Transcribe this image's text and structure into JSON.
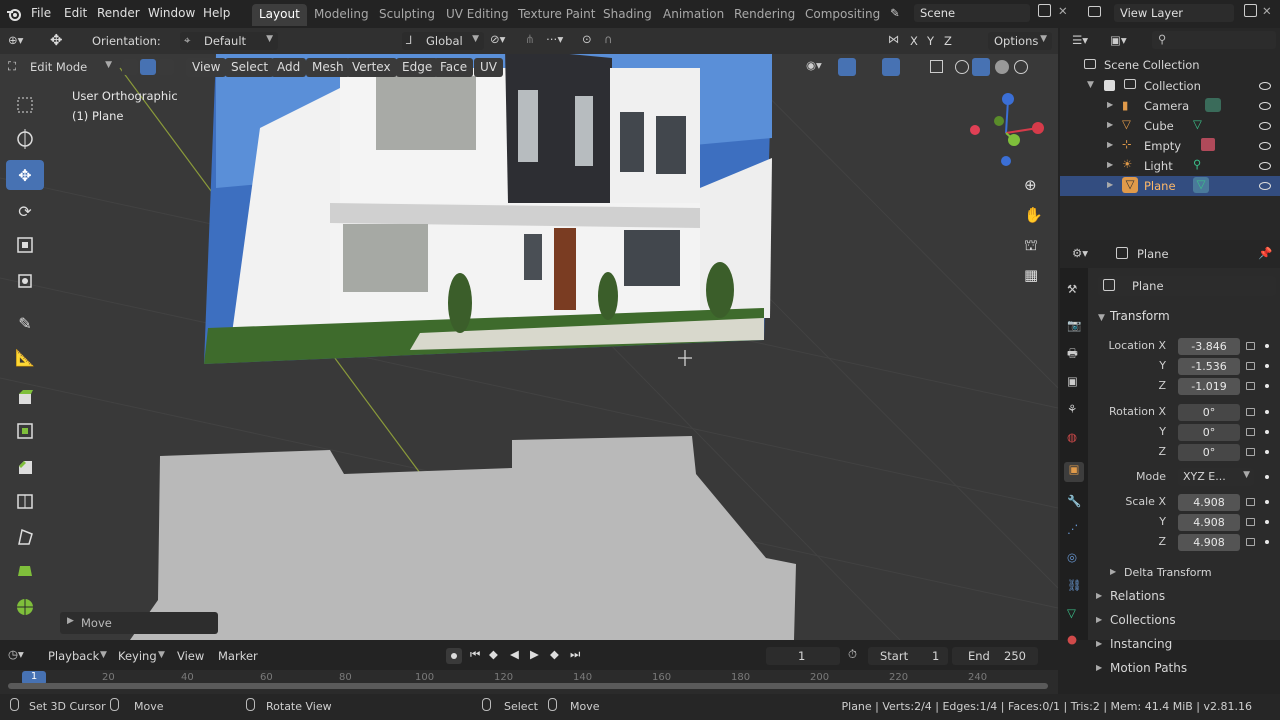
{
  "menu": [
    "File",
    "Edit",
    "Render",
    "Window",
    "Help"
  ],
  "workspaces": [
    {
      "label": "Layout",
      "active": true
    },
    {
      "label": "Modeling"
    },
    {
      "label": "Sculpting"
    },
    {
      "label": "UV Editing"
    },
    {
      "label": "Texture Paint"
    },
    {
      "label": "Shading"
    },
    {
      "label": "Animation"
    },
    {
      "label": "Rendering"
    },
    {
      "label": "Compositing"
    }
  ],
  "scene": "Scene",
  "view_layer": "View Layer",
  "tool_settings": {
    "orientation_label": "Orientation:",
    "orientation_value": "Default",
    "transform_orientation": "Global",
    "options": "Options",
    "axes": [
      "X",
      "Y",
      "Z"
    ]
  },
  "viewport_header": {
    "mode": "Edit Mode",
    "menus": [
      "View",
      "Select",
      "Add",
      "Mesh",
      "Vertex",
      "Edge",
      "Face",
      "UV"
    ]
  },
  "viewport_overlay": {
    "view_name": "User Orthographic",
    "object": "(1) Plane"
  },
  "last_op": "Move",
  "outliner": {
    "root": "Scene Collection",
    "collection": "Collection",
    "items": [
      {
        "name": "Camera",
        "icon": "camera-icon"
      },
      {
        "name": "Cube",
        "icon": "mesh-icon"
      },
      {
        "name": "Empty",
        "icon": "empty-icon"
      },
      {
        "name": "Light",
        "icon": "light-icon"
      },
      {
        "name": "Plane",
        "icon": "mesh-icon",
        "selected": true
      }
    ]
  },
  "properties": {
    "object_name": "Plane",
    "data_name": "Plane",
    "transform_header": "Transform",
    "location": {
      "label": "Location X",
      "x": "-3.846",
      "y": "-1.536",
      "z": "-1.019"
    },
    "rotation": {
      "label": "Rotation X",
      "x": "0°",
      "y": "0°",
      "z": "0°"
    },
    "mode_label": "Mode",
    "mode_value": "XYZ E...",
    "scale": {
      "label": "Scale X",
      "x": "4.908",
      "y": "4.908",
      "z": "4.908"
    },
    "y_label": "Y",
    "z_label": "Z",
    "subpanels": [
      "Delta Transform",
      "Relations",
      "Collections",
      "Instancing",
      "Motion Paths"
    ]
  },
  "timeline": {
    "menus": [
      "Playback",
      "Keying",
      "View",
      "Marker"
    ],
    "current_frame": "1",
    "start_label": "Start",
    "start": "1",
    "end_label": "End",
    "end": "250",
    "ticks": [
      "1",
      "20",
      "40",
      "60",
      "80",
      "100",
      "120",
      "140",
      "160",
      "180",
      "200",
      "220",
      "240"
    ]
  },
  "statusbar": {
    "left": [
      {
        "icon": "mouse-left-icon",
        "label": "Set 3D Cursor"
      },
      {
        "icon": "mouse-left-icon",
        "label": "Move"
      },
      {
        "icon": "mouse-middle-icon",
        "label": "Rotate View"
      },
      {
        "icon": "mouse-left-icon",
        "label": "Select"
      },
      {
        "icon": "mouse-right-icon",
        "label": "Move"
      }
    ],
    "stats": "Plane | Verts:2/4 | Edges:1/4 | Faces:0/1 | Tris:2 | Mem: 41.4 MiB | v2.81.16"
  }
}
